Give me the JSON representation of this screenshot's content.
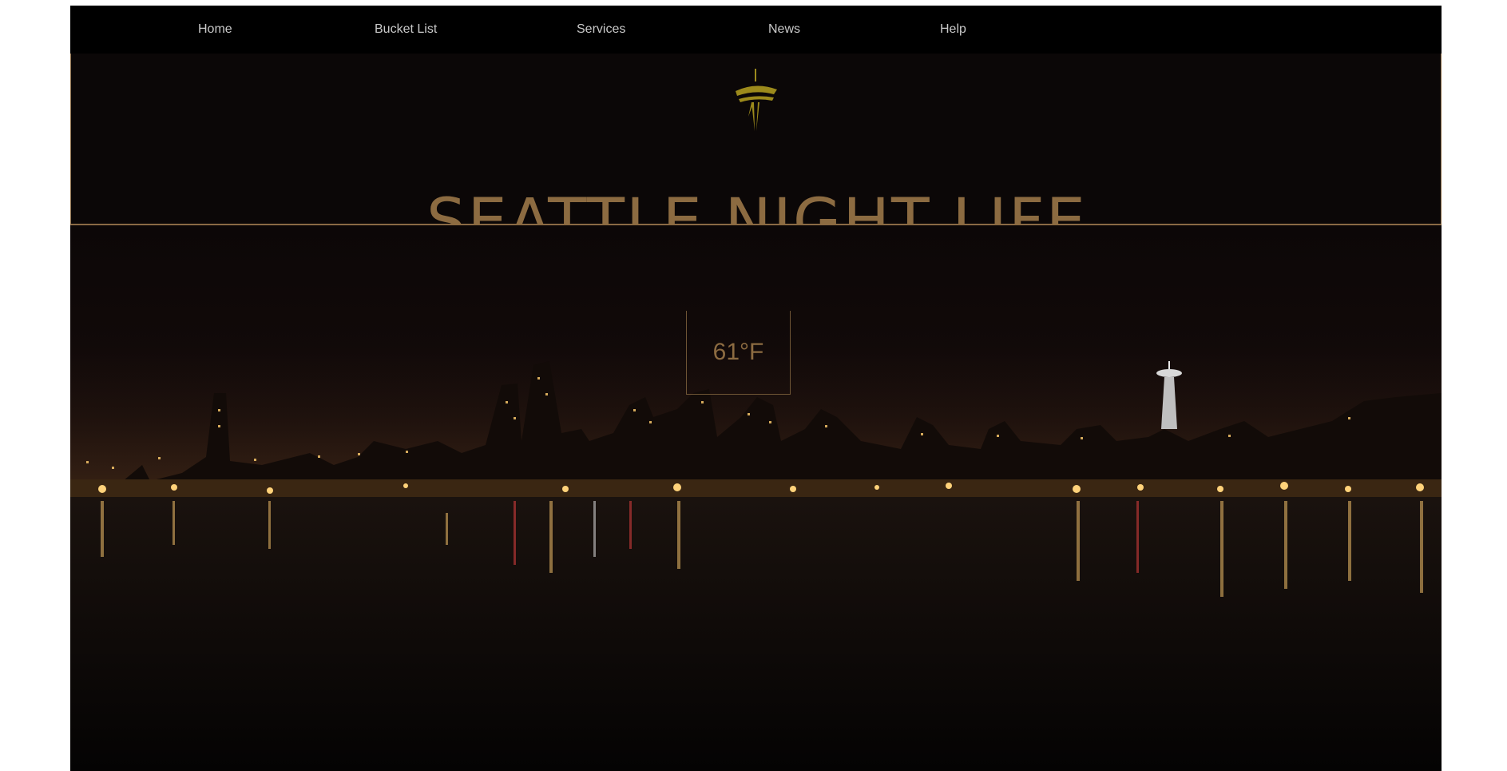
{
  "nav": {
    "items": [
      {
        "label": "Home"
      },
      {
        "label": "Bucket List"
      },
      {
        "label": "Services"
      },
      {
        "label": "News"
      },
      {
        "label": "Help"
      }
    ]
  },
  "header": {
    "logo_icon": "space-needle-icon",
    "title": "SEATTLE NIGHT LIFE"
  },
  "hero": {
    "image": "seattle-skyline-night-photo",
    "weather": {
      "temperature": "61°F"
    }
  },
  "colors": {
    "accent": "#8c6b41",
    "logo": "#9c8a1c",
    "nav_bg": "#000000",
    "nav_text": "#c9c9c9"
  }
}
